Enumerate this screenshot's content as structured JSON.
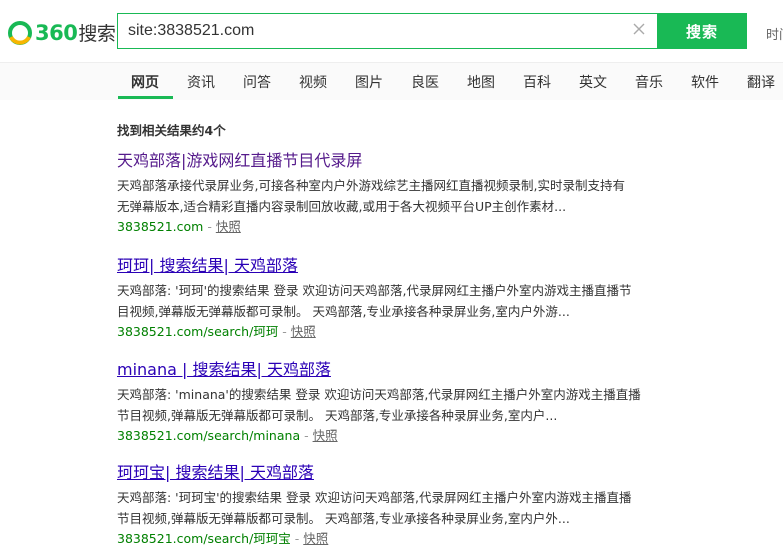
{
  "header": {
    "logo_num": "360",
    "logo_zh": "搜索",
    "query": "site:3838521.com",
    "search_button": "搜索",
    "right_link": "时间"
  },
  "nav": {
    "tabs": [
      "网页",
      "资讯",
      "问答",
      "视频",
      "图片",
      "良医",
      "地图",
      "百科",
      "英文",
      "音乐",
      "软件",
      "翻译"
    ],
    "active": "网页"
  },
  "results_count": "找到相关结果约4个",
  "results": [
    {
      "title": "天鸡部落|游戏网红直播节目代录屏",
      "desc_line1": "天鸡部落承接代录屏业务,可接各种室内户外游戏综艺主播网红直播视频录制,实时录制支持有",
      "desc_line2": "无弹幕版本,适合精彩直播内容录制回放收藏,或用于各大视频平台UP主创作素材...",
      "url": "3838521.com",
      "sep": " - ",
      "cache": "快照"
    },
    {
      "title": "珂珂| 搜索结果| 天鸡部落",
      "desc_line1": "天鸡部落: '珂珂'的搜索结果 登录 欢迎访问天鸡部落,代录屏网红主播户外室内游戏主播直播节",
      "desc_line2": "目视频,弹幕版无弹幕版都可录制。 天鸡部落,专业承接各种录屏业务,室内户外游...",
      "url": "3838521.com/search/珂珂",
      "sep": " - ",
      "cache": "快照"
    },
    {
      "title": "minana | 搜索结果| 天鸡部落",
      "desc_line1": "天鸡部落: 'minana'的搜索结果 登录 欢迎访问天鸡部落,代录屏网红主播户外室内游戏主播直播",
      "desc_line2": "节目视频,弹幕版无弹幕版都可录制。 天鸡部落,专业承接各种录屏业务,室内户...",
      "url": "3838521.com/search/minana",
      "sep": " - ",
      "cache": "快照"
    },
    {
      "title": "珂珂宝| 搜索结果| 天鸡部落",
      "desc_line1": "天鸡部落: '珂珂宝'的搜索结果 登录 欢迎访问天鸡部落,代录屏网红主播户外室内游戏主播直播",
      "desc_line2": "节目视频,弹幕版无弹幕版都可录制。 天鸡部落,专业承接各种录屏业务,室内户外...",
      "url": "3838521.com/search/珂珂宝",
      "sep": " - ",
      "cache": "快照"
    }
  ],
  "colors": {
    "brand_green": "#19b955",
    "link": "#2a00b6",
    "visited": "#551a8b",
    "url_green": "#008000"
  }
}
